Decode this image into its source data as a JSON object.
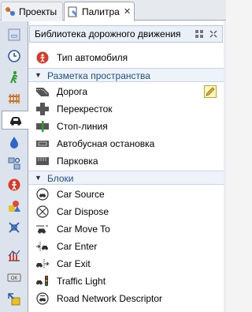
{
  "tabs": [
    {
      "label": "Проекты",
      "icon": "projects-icon"
    },
    {
      "label": "Палитра",
      "icon": "palette-icon",
      "active": true
    }
  ],
  "palette": {
    "title": "Библиотека дорожного движения",
    "top_items": [
      {
        "label": "Тип автомобиля",
        "icon": "car-type-icon"
      }
    ],
    "sections": [
      {
        "label": "Разметка пространства",
        "items": [
          {
            "label": "Дорога",
            "icon": "road-icon"
          },
          {
            "label": "Перекресток",
            "icon": "intersection-icon"
          },
          {
            "label": "Стоп-линия",
            "icon": "stop-line-icon"
          },
          {
            "label": "Автобусная остановка",
            "icon": "bus-stop-icon"
          },
          {
            "label": "Парковка",
            "icon": "parking-icon"
          }
        ]
      },
      {
        "label": "Блоки",
        "items": [
          {
            "label": "Car Source",
            "icon": "car-source-icon"
          },
          {
            "label": "Car Dispose",
            "icon": "car-dispose-icon"
          },
          {
            "label": "Car Move To",
            "icon": "car-move-to-icon"
          },
          {
            "label": "Car Enter",
            "icon": "car-enter-icon"
          },
          {
            "label": "Car Exit",
            "icon": "car-exit-icon"
          },
          {
            "label": "Traffic Light",
            "icon": "traffic-light-icon"
          },
          {
            "label": "Road Network Descriptor",
            "icon": "road-network-descriptor-icon"
          }
        ]
      }
    ]
  },
  "colors": {
    "accent": "#1f4f8f",
    "section_bg": "#eef3fa",
    "rail_bg": "#dde3ec"
  }
}
